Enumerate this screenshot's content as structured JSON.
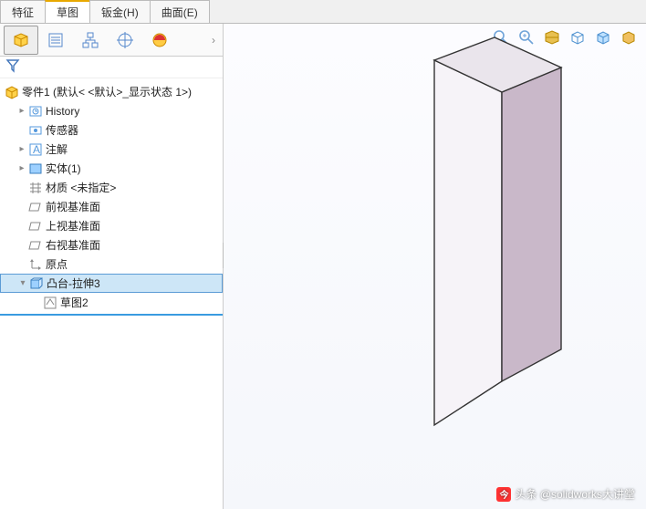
{
  "tabs": {
    "feature": "特征",
    "sketch": "草图",
    "sheetmetal": "钣金(H)",
    "surface": "曲面(E)"
  },
  "tree": {
    "root": "零件1  (默认< <默认>_显示状态 1>)",
    "history": "History",
    "sensors": "传感器",
    "annotations": "注解",
    "solids": "实体(1)",
    "material": "材质 <未指定>",
    "front": "前视基准面",
    "top": "上视基准面",
    "right": "右视基准面",
    "origin": "原点",
    "extrude": "凸台-拉伸3",
    "sketch2": "草图2"
  },
  "watermark": "头条 @solidworks大讲堂"
}
